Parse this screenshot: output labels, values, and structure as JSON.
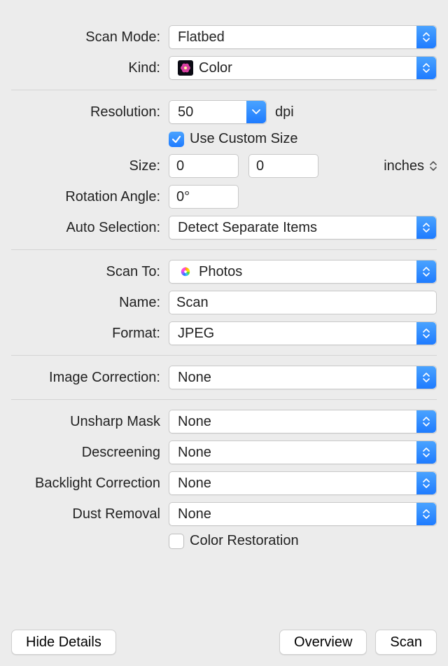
{
  "labels": {
    "scanMode": "Scan Mode:",
    "kind": "Kind:",
    "resolution": "Resolution:",
    "dpi": "dpi",
    "useCustomSize": "Use Custom Size",
    "size": "Size:",
    "inches": "inches",
    "rotation": "Rotation Angle:",
    "autoSelection": "Auto Selection:",
    "scanTo": "Scan To:",
    "name": "Name:",
    "format": "Format:",
    "imageCorrection": "Image Correction:",
    "unsharpMask": "Unsharp Mask",
    "descreening": "Descreening",
    "backlight": "Backlight Correction",
    "dustRemoval": "Dust Removal",
    "colorRestoration": "Color Restoration"
  },
  "values": {
    "scanMode": "Flatbed",
    "kind": "Color",
    "resolution": "50",
    "useCustomSize": true,
    "width": "0",
    "height": "0",
    "rotation": "0°",
    "autoSelection": "Detect Separate Items",
    "scanTo": "Photos",
    "name": "Scan",
    "format": "JPEG",
    "imageCorrection": "None",
    "unsharpMask": "None",
    "descreening": "None",
    "backlight": "None",
    "dustRemoval": "None",
    "colorRestoration": false
  },
  "buttons": {
    "hideDetails": "Hide Details",
    "overview": "Overview",
    "scan": "Scan"
  }
}
